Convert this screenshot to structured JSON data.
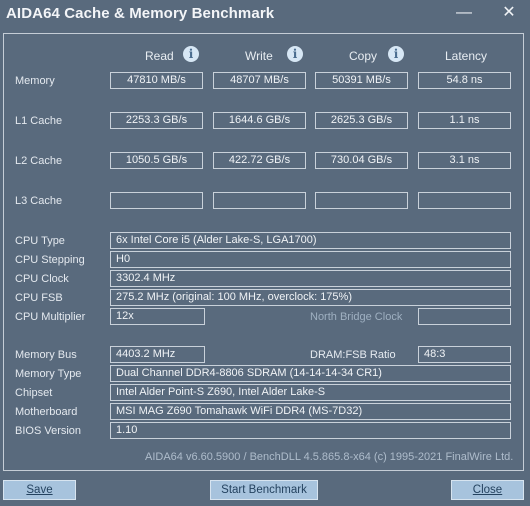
{
  "window": {
    "title": "AIDA64 Cache & Memory Benchmark",
    "minimize_glyph": "—",
    "close_glyph": "✕"
  },
  "columns": {
    "read": "Read",
    "write": "Write",
    "copy": "Copy",
    "latency": "Latency",
    "info_glyph": "i"
  },
  "rows": {
    "memory": {
      "label": "Memory",
      "read": "47810 MB/s",
      "write": "48707 MB/s",
      "copy": "50391 MB/s",
      "latency": "54.8 ns"
    },
    "l1": {
      "label": "L1 Cache",
      "read": "2253.3 GB/s",
      "write": "1644.6 GB/s",
      "copy": "2625.3 GB/s",
      "latency": "1.1 ns"
    },
    "l2": {
      "label": "L2 Cache",
      "read": "1050.5 GB/s",
      "write": "422.72 GB/s",
      "copy": "730.04 GB/s",
      "latency": "3.1 ns"
    },
    "l3": {
      "label": "L3 Cache",
      "read": "",
      "write": "",
      "copy": "",
      "latency": ""
    }
  },
  "cpu": {
    "type_label": "CPU Type",
    "type_value": "6x Intel Core i5  (Alder Lake-S, LGA1700)",
    "stepping_label": "CPU Stepping",
    "stepping_value": "H0",
    "clock_label": "CPU Clock",
    "clock_value": "3302.4 MHz",
    "fsb_label": "CPU FSB",
    "fsb_value": "275.2 MHz  (original: 100 MHz, overclock: 175%)",
    "multiplier_label": "CPU Multiplier",
    "multiplier_value": "12x",
    "north_bridge_clock": "North Bridge Clock"
  },
  "system": {
    "memory_bus_label": "Memory Bus",
    "memory_bus_value": "4403.2 MHz",
    "dram_fsb_label": "DRAM:FSB Ratio",
    "dram_fsb_value": "48:3",
    "memory_type_label": "Memory Type",
    "memory_type_value": "Dual Channel DDR4-8806 SDRAM  (14-14-14-34 CR1)",
    "chipset_label": "Chipset",
    "chipset_value": "Intel Alder Point-S Z690, Intel Alder Lake-S",
    "motherboard_label": "Motherboard",
    "motherboard_value": "MSI MAG Z690 Tomahawk WiFi DDR4 (MS-7D32)",
    "bios_label": "BIOS Version",
    "bios_value": "1.10"
  },
  "footer": "AIDA64 v6.60.5900 / BenchDLL 4.5.865.8-x64  (c) 1995-2021 FinalWire Ltd.",
  "buttons": {
    "save": "Save",
    "start": "Start Benchmark",
    "close": "Close"
  }
}
